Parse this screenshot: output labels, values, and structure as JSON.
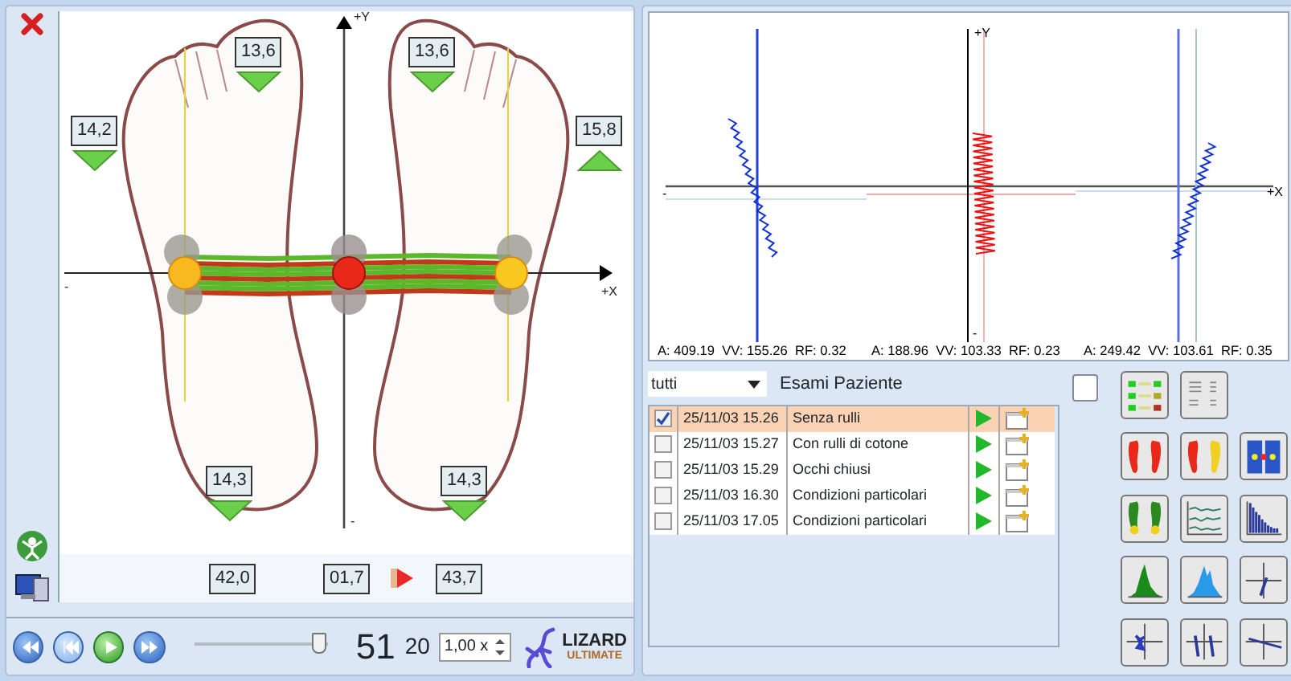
{
  "foot_map": {
    "axis_labels": [
      "+Y",
      "+X",
      "-",
      "-"
    ],
    "markers": [
      {
        "value": "13,6",
        "pointing_up": false
      },
      {
        "value": "13,6",
        "pointing_up": false
      },
      {
        "value": "14,2",
        "pointing_up": false
      },
      {
        "value": "15,8",
        "pointing_up": true
      },
      {
        "value": "14,3",
        "pointing_up": false
      },
      {
        "value": "14,3",
        "pointing_up": false
      }
    ],
    "readings": [
      "42,0",
      "01,7",
      "43,7"
    ]
  },
  "playback": {
    "slider": {
      "level": 0.93
    },
    "frame": "51",
    "fps": "20",
    "speed": "1,00 x"
  },
  "logo": {
    "title": "LIZARD",
    "subtitle": "ULTIMATE"
  },
  "stabilogram": {
    "axis_labels": [
      "+Y",
      "+X",
      "-",
      "-"
    ],
    "stats": [
      "A: 409.19  VV: 155.26  RF: 0.32",
      "A: 188.96  VV: 103.33  RF: 0.23",
      "A: 249.42  VV: 103.61  RF: 0.35"
    ]
  },
  "exam_filter": {
    "value": "tutti"
  },
  "exams_title": "Esami Paziente",
  "exams": [
    {
      "date": "25/11/03 15.26",
      "description": "Senza rulli",
      "checked": true,
      "selected": true
    },
    {
      "date": "25/11/03 15.27",
      "description": "Con rulli di cotone",
      "checked": false,
      "selected": false
    },
    {
      "date": "25/11/03 15.29",
      "description": "Occhi chiusi",
      "checked": false,
      "selected": false
    },
    {
      "date": "25/11/03 16.30",
      "description": "Condizioni particolari",
      "checked": false,
      "selected": false
    },
    {
      "date": "25/11/03 17.05",
      "description": "Condizioni particolari",
      "checked": false,
      "selected": false
    }
  ]
}
